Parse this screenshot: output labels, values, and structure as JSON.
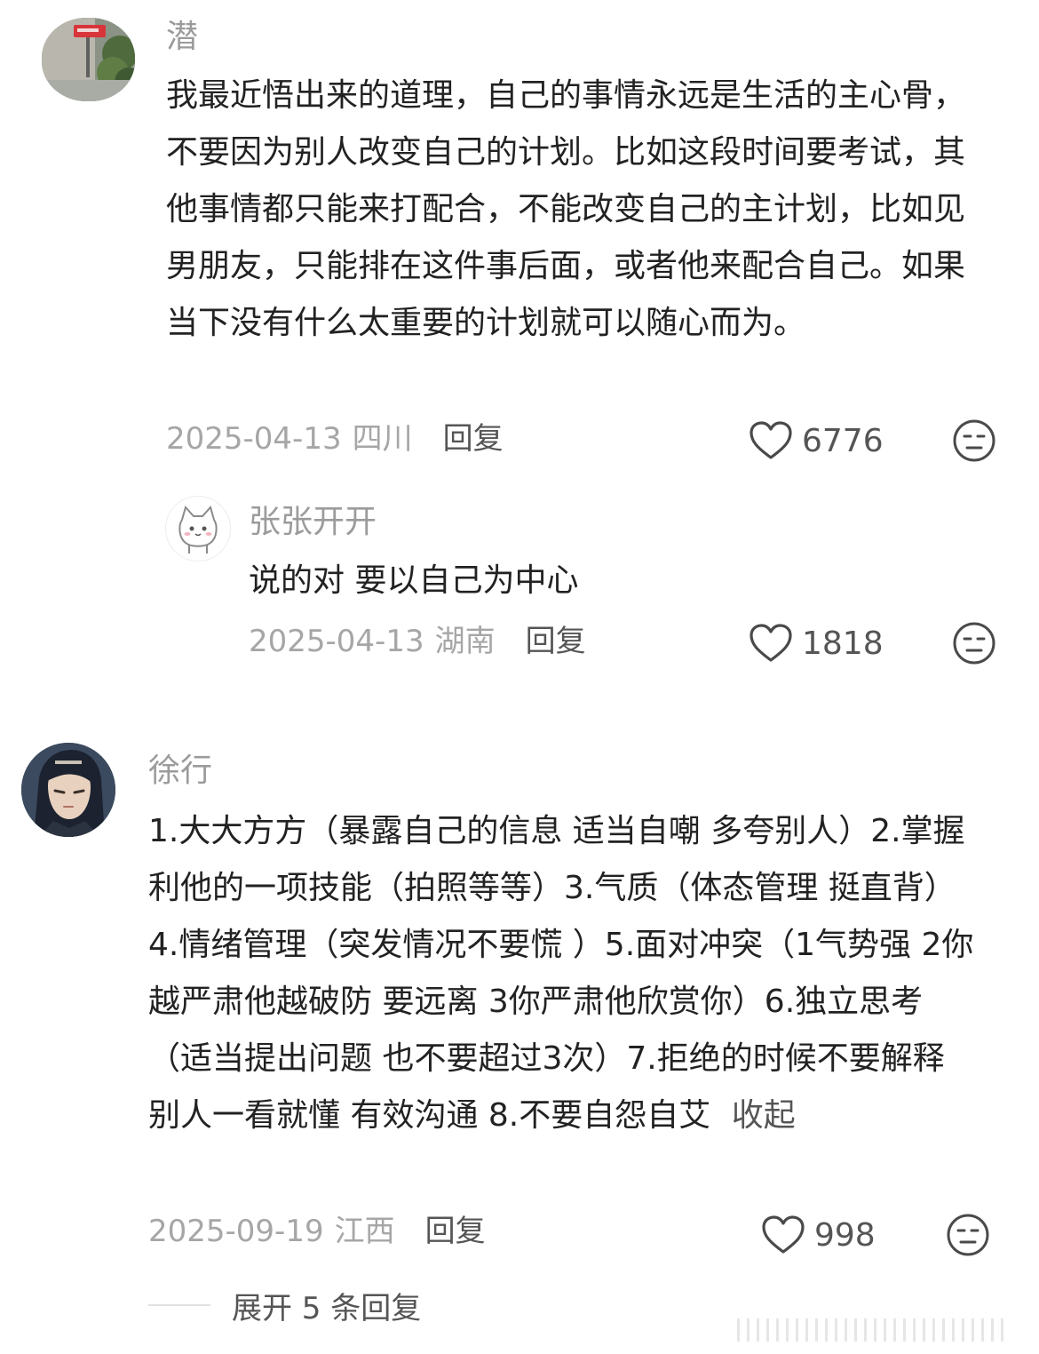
{
  "comments": [
    {
      "username": "潜",
      "text": "我最近悟出来的道理，自己的事情永远是生活的主心骨，不要因为别人改变自己的计划。比如这段时间要考试，其他事情都只能来打配合，不能改变自己的主计划，比如见男朋友，只能排在这件事后面，或者他来配合自己。如果当下没有什么太重要的计划就可以随心而为。",
      "date": "2025-04-13",
      "location": "四川",
      "reply_label": "回复",
      "likes": "6776",
      "replies": [
        {
          "username": "张张开开",
          "text": "说的对 要以自己为中心",
          "date": "2025-04-13",
          "location": "湖南",
          "reply_label": "回复",
          "likes": "1818"
        }
      ]
    },
    {
      "username": "徐行",
      "text": "1.大大方方（暴露自己的信息 适当自嘲 多夸别人）2.掌握利他的一项技能（拍照等等）3.气质（体态管理 挺直背）4.情绪管理（突发情况不要慌 ）5.面对冲突（1气势强 2你越严肃他越破防 要远离 3你严肃他欣赏你）6.独立思考（适当提出问题 也不要超过3次）7.拒绝的时候不要解释 别人一看就懂 有效沟通 8.不要自怨自艾",
      "collapse_label": "收起",
      "date": "2025-09-19",
      "location": "江西",
      "reply_label": "回复",
      "likes": "998",
      "expand_label": "展开 5 条回复"
    }
  ],
  "icons": {
    "like": "heart-outline-icon",
    "dislike": "neutral-face-icon"
  },
  "colors": {
    "username": "#9b9b9b",
    "text": "#222222",
    "meta": "#a6a6a6",
    "action": "#555555"
  }
}
